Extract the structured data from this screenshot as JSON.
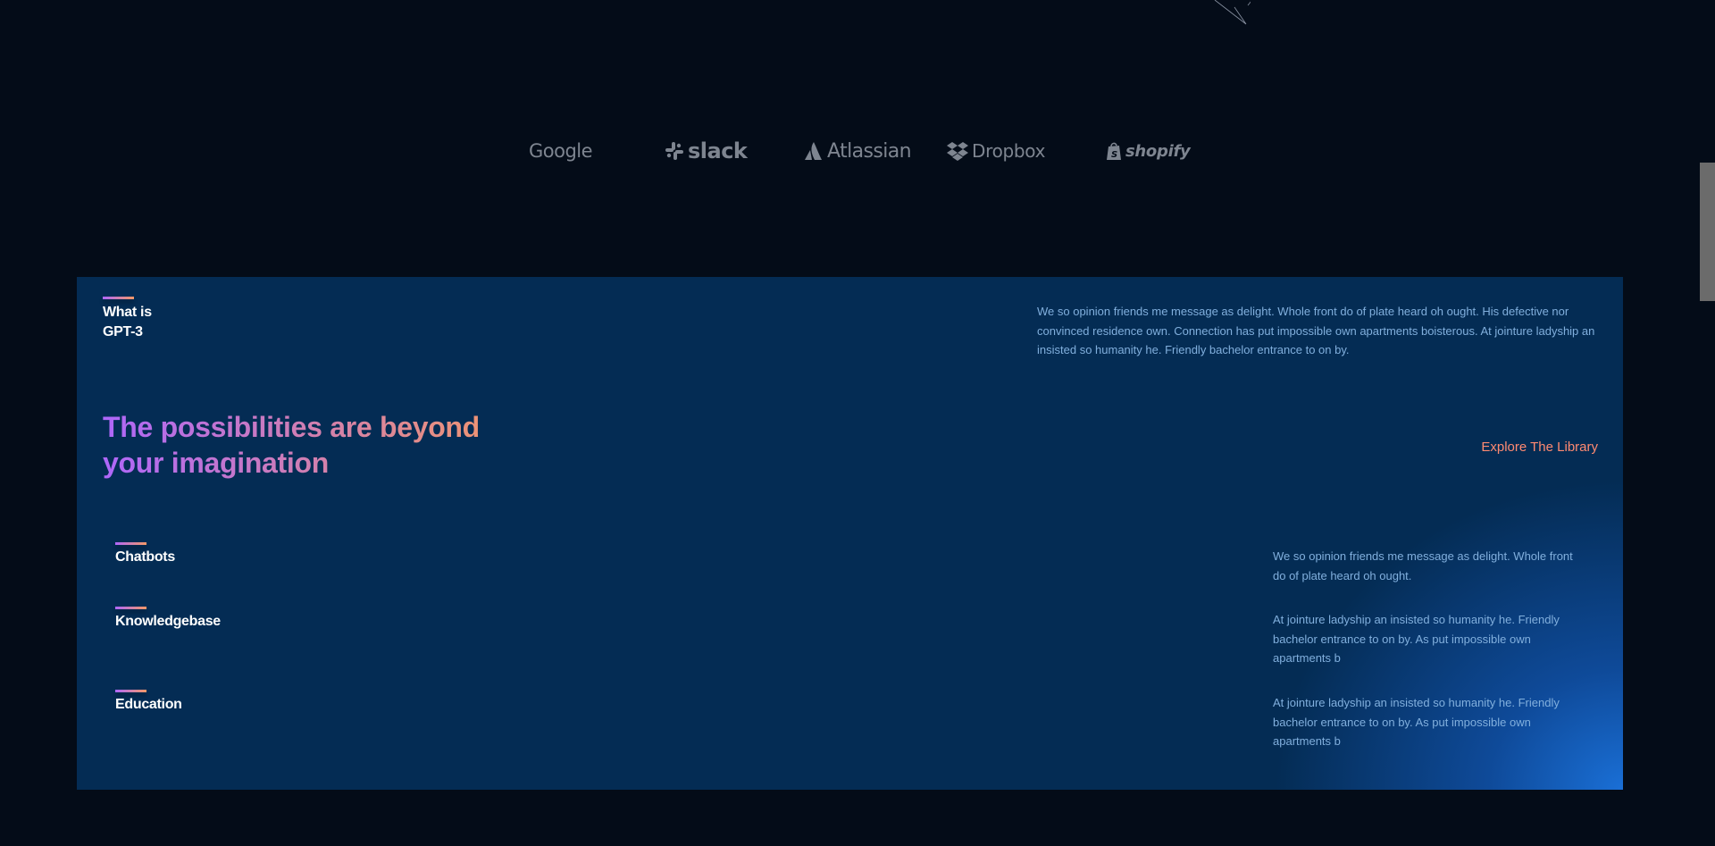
{
  "brands": [
    {
      "name": "Google",
      "icon": "google-logo"
    },
    {
      "name": "slack",
      "icon": "slack-logo"
    },
    {
      "name": "Atlassian",
      "icon": "atlassian-logo"
    },
    {
      "name": "Dropbox",
      "icon": "dropbox-logo"
    },
    {
      "name": "shopify",
      "icon": "shopify-logo"
    }
  ],
  "whatgpt": {
    "title": "What is GPT-3",
    "description": "We so opinion friends me message as delight. Whole front do of plate heard oh ought. His defective nor convinced residence own. Connection has put impossible own apartments boisterous. At jointure ladyship an insisted so humanity he. Friendly bachelor entrance to on by.",
    "headline": "The possibilities are beyond your imagination",
    "explore_label": "Explore The Library",
    "features": [
      {
        "title": "Chatbots",
        "text": "We so opinion friends me message as delight. Whole front do of plate heard oh ought."
      },
      {
        "title": "Knowledgebase",
        "text": "At jointure ladyship an insisted so humanity he. Friendly bachelor entrance to on by. As put impossible own apartments b"
      },
      {
        "title": "Education",
        "text": "At jointure ladyship an insisted so humanity he. Friendly bachelor entrance to on by. As put impossible own apartments b"
      }
    ]
  },
  "colors": {
    "page_bg": "#040c18",
    "card_bg": "#042c54",
    "accent_gradient_start": "#ae67fa",
    "accent_gradient_end": "#f49867",
    "link": "#ff8a71",
    "body_text": "#81afdd",
    "brand_logo": "#7e8590"
  }
}
